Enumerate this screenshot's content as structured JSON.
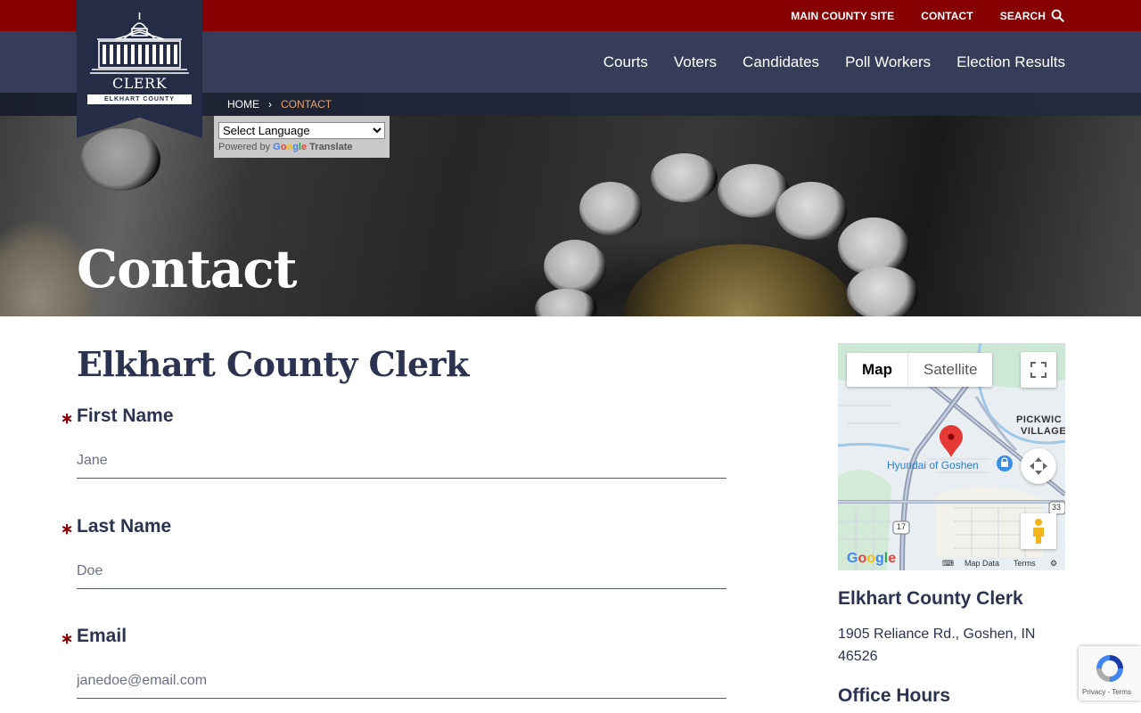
{
  "topbar": {
    "links": [
      "MAIN COUNTY SITE",
      "CONTACT",
      "SEARCH"
    ]
  },
  "nav": {
    "items": [
      "Courts",
      "Voters",
      "Candidates",
      "Poll Workers",
      "Election Results"
    ]
  },
  "logo": {
    "title": "CLERK",
    "subtitle": "ELKHART COUNTY"
  },
  "breadcrumb": {
    "home": "HOME",
    "separator": "›",
    "current": "CONTACT"
  },
  "translate": {
    "select_value": "Select Language",
    "powered_by": "Powered by",
    "google": "Google",
    "translate_word": "Translate"
  },
  "hero": {
    "title": "Contact"
  },
  "form": {
    "heading": "Elkhart County Clerk",
    "required_mark": "∗",
    "fields": [
      {
        "label": "First Name",
        "placeholder": "Jane"
      },
      {
        "label": "Last Name",
        "placeholder": "Doe"
      },
      {
        "label": "Email",
        "placeholder": "janedoe@email.com"
      }
    ]
  },
  "map": {
    "tab_map": "Map",
    "tab_satellite": "Satellite",
    "place_label": "Hyundai of Goshen",
    "area_label_1": "PICKWIC",
    "area_label_2": "VILLAGE",
    "route_shield_1": "17",
    "route_shield_2": "33",
    "footer_map_data": "Map Data",
    "footer_terms": "Terms",
    "google": "Google"
  },
  "sidebar": {
    "org_name": "Elkhart County Clerk",
    "address": "1905 Reliance Rd., Goshen, IN 46526",
    "hours_heading": "Office Hours"
  },
  "recaptcha": {
    "footer": "Privacy - Terms"
  },
  "colors": {
    "topbar": "#870000",
    "navbar": "#353d59",
    "accent": "#e8a46c",
    "text": "#2b3350"
  }
}
